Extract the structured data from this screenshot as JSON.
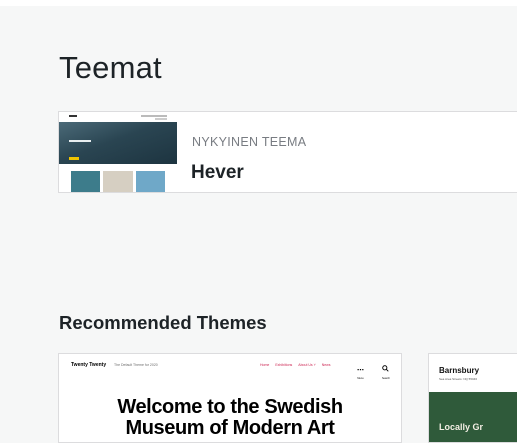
{
  "page": {
    "title": "Teemat"
  },
  "current_theme": {
    "type_label": "NYKYINEN TEEMA",
    "name": "Hever",
    "thumbnail_tile_colors": [
      "#3d7c8b",
      "#d6cfc2",
      "#6fa8c8"
    ]
  },
  "recommended": {
    "heading": "Recommended Themes",
    "themes": [
      {
        "site_title": "Twenty Twenty",
        "tagline": "The Default Theme for 2020",
        "menu": [
          "Home",
          "Exhibitions",
          "About Us ˅",
          "News"
        ],
        "more_label": "Menu",
        "search_label": "Search",
        "hero_line1": "Welcome to the Swedish",
        "hero_line2": "Museum of Modern Art"
      },
      {
        "site_title": "Barnsbury",
        "tagline": "Sea Area Streets: NQ 55046",
        "hero_text": "Locally Gr"
      }
    ]
  },
  "colors": {
    "background": "#f6f7f7",
    "accent_link": "#cd2653",
    "barnsbury_green": "#2f5a3a"
  }
}
